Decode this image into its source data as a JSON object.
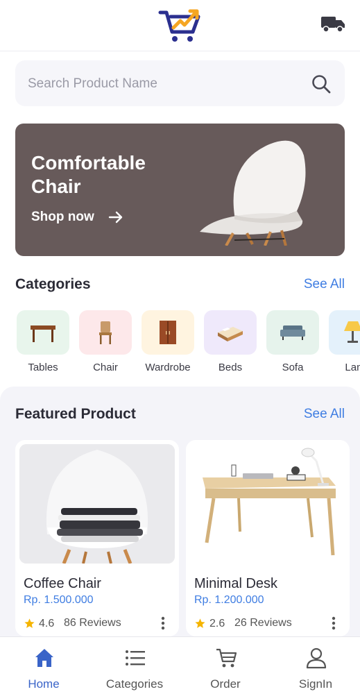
{
  "header": {
    "logo": "cart-logo-icon",
    "delivery_icon": "truck-icon"
  },
  "search": {
    "placeholder": "Search Product Name",
    "icon": "search-icon"
  },
  "banner": {
    "title": "Comfortable Chair",
    "cta": "Shop now",
    "background": "#675a5a"
  },
  "categories": {
    "title": "Categories",
    "see_all": "See All",
    "items": [
      {
        "label": "Tables",
        "color": "#e8f5ec"
      },
      {
        "label": "Chair",
        "color": "#fde8ea"
      },
      {
        "label": "Wardrobe",
        "color": "#fff4e0"
      },
      {
        "label": "Beds",
        "color": "#efe9fb"
      },
      {
        "label": "Sofa",
        "color": "#e6f3ec"
      },
      {
        "label": "Lam",
        "color": "#e4f1fb"
      }
    ]
  },
  "featured": {
    "title": "Featured Product",
    "see_all": "See All",
    "products": [
      {
        "name": "Coffee Chair",
        "price": "Rp. 1.500.000",
        "rating": "4.6",
        "reviews": "86 Reviews"
      },
      {
        "name": "Minimal Desk",
        "price": "Rp. 1.200.000",
        "rating": "2.6",
        "reviews": "26 Reviews"
      }
    ]
  },
  "nav": {
    "items": [
      {
        "label": "Home",
        "active": true
      },
      {
        "label": "Categories"
      },
      {
        "label": "Order"
      },
      {
        "label": "SignIn"
      }
    ]
  },
  "colors": {
    "accent": "#3f7de2",
    "active_nav": "#3a64c8",
    "star": "#f5b400"
  }
}
